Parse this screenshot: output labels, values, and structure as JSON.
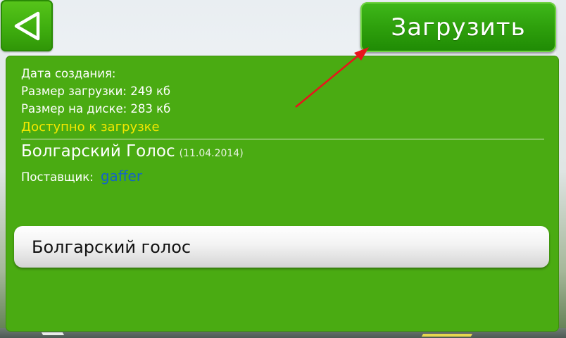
{
  "toolbar": {
    "back_icon": "back-triangle-icon",
    "load_label": "Загрузить"
  },
  "info": {
    "created_label": "Дата создания:",
    "download_size": "Размер загрузки: 249 кб",
    "disk_size": "Размер на диске: 283 кб",
    "status": "Доступно к загрузке"
  },
  "item": {
    "title": "Болгарский Голос",
    "date": "(11.04.2014)",
    "provider_label": "Поставщик:",
    "provider_value": "gaffer"
  },
  "list": {
    "items": [
      {
        "label": "Болгарский голос"
      }
    ]
  },
  "annotation": {
    "arrow_color": "#e8141c"
  },
  "colors": {
    "panel": "#4aab12",
    "button": "#2ea00c",
    "status": "#f3e800",
    "provider": "#1463c8"
  }
}
